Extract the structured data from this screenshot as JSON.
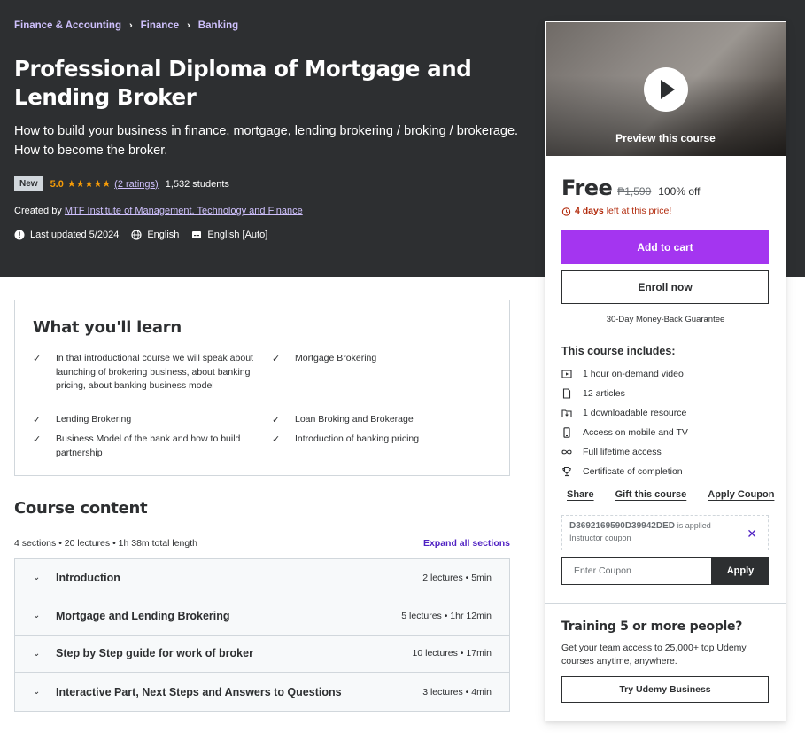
{
  "breadcrumb": [
    "Finance & Accounting",
    "Finance",
    "Banking"
  ],
  "course": {
    "title": "Professional Diploma of Mortgage and Lending Broker",
    "subtitle": "How to build your business in finance, mortgage, lending brokering / broking / brokerage. How to become the broker.",
    "badge": "New",
    "rating": "5.0",
    "stars": "★★★★★",
    "ratings_link": "(2 ratings)",
    "students": "1,532 students",
    "created_by_label": "Created by",
    "creator": "MTF Institute of Management, Technology and Finance",
    "last_updated": "Last updated 5/2024",
    "language": "English",
    "captions": "English [Auto]"
  },
  "learn": {
    "title": "What you'll learn",
    "items": [
      "In that introductional course we will speak about launching of brokering business, about banking pricing, about banking business model",
      "Mortgage Brokering",
      "Lending Brokering",
      "Loan Broking and Brokerage",
      "Business Model of the bank and how to build partnership",
      "Introduction of banking pricing"
    ]
  },
  "content": {
    "title": "Course content",
    "summary": "4 sections • 20 lectures • 1h 38m total length",
    "expand_label": "Expand all sections",
    "sections": [
      {
        "name": "Introduction",
        "stats": "2 lectures • 5min"
      },
      {
        "name": "Mortgage and Lending Brokering",
        "stats": "5 lectures • 1hr 12min"
      },
      {
        "name": "Step by Step guide for work of broker",
        "stats": "10 lectures • 17min"
      },
      {
        "name": "Interactive Part, Next Steps and Answers to Questions",
        "stats": "3 lectures • 4min"
      }
    ]
  },
  "sidebar": {
    "preview_label": "Preview this course",
    "price": "Free",
    "old_price": "₱1,590",
    "discount": "100% off",
    "timer_bold": "4 days",
    "timer_rest": "left at this price!",
    "add_to_cart": "Add to cart",
    "enroll": "Enroll now",
    "guarantee": "30-Day Money-Back Guarantee",
    "includes_title": "This course includes:",
    "includes": [
      {
        "icon": "video-icon",
        "label": "1 hour on-demand video"
      },
      {
        "icon": "file-icon",
        "label": "12 articles"
      },
      {
        "icon": "download-icon",
        "label": "1 downloadable resource"
      },
      {
        "icon": "mobile-icon",
        "label": "Access on mobile and TV"
      },
      {
        "icon": "infinity-icon",
        "label": "Full lifetime access"
      },
      {
        "icon": "trophy-icon",
        "label": "Certificate of completion"
      }
    ],
    "links": [
      "Share",
      "Gift this course",
      "Apply Coupon"
    ],
    "coupon_code": "D3692169590D39942DED",
    "coupon_applied": "is applied",
    "coupon_sub": "Instructor coupon",
    "coupon_placeholder": "Enter Coupon",
    "coupon_apply": "Apply",
    "training_title": "Training 5 or more people?",
    "training_text": "Get your team access to 25,000+ top Udemy courses anytime, anywhere.",
    "business_button": "Try Udemy Business"
  },
  "colors": {
    "hero_bg": "#2d2f31",
    "accent_purple": "#a435f0",
    "link_purple": "#cec0fc",
    "star_orange": "#f69c08",
    "timer_red": "#b32d0f"
  }
}
